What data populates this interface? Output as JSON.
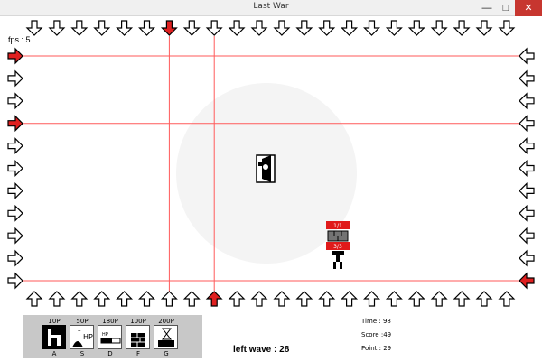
{
  "window": {
    "title": "Last War",
    "minimize": "—",
    "maximize": "□",
    "close": "✕"
  },
  "hud": {
    "fps_label": "fps : 5",
    "left_wave": "left wave : 28"
  },
  "stats": [
    {
      "label": "Time : ",
      "value": "98"
    },
    {
      "label": "Score :",
      "value": "49"
    },
    {
      "label": "Point : ",
      "value": "29"
    }
  ],
  "shop": [
    {
      "cost": "10P",
      "key": "A",
      "icon": "wall-block-icon",
      "selected": true
    },
    {
      "cost": "50P",
      "key": "S",
      "icon": "heal-hp-icon",
      "selected": false
    },
    {
      "cost": "180P",
      "key": "D",
      "icon": "gun-turret-icon",
      "selected": false
    },
    {
      "cost": "100P",
      "key": "F",
      "icon": "brick-wall-icon",
      "selected": false
    },
    {
      "cost": "200P",
      "key": "G",
      "icon": "hourglass-icon",
      "selected": false
    }
  ],
  "unit": {
    "hp_top": "1/1",
    "hp_bottom": "3/3"
  },
  "colors": {
    "guide_line": "#ff5a5a",
    "active_arrow": "#e02020",
    "arrow_outline": "#000000",
    "shop_bg": "#c8c8c8"
  },
  "spawn_arrows": {
    "top_active": [
      6
    ],
    "bottom_active": [
      8
    ],
    "left_active": [
      0,
      3
    ],
    "right_active": [
      10
    ]
  }
}
